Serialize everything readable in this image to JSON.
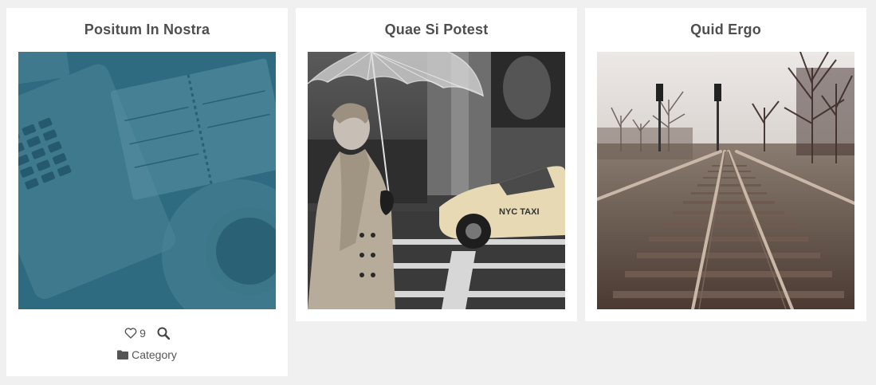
{
  "cards": [
    {
      "title": "Positum In Nostra",
      "image": "workspace-desk-teal-photo",
      "likes": "9",
      "category": "Category"
    },
    {
      "title": "Quae Si Potest",
      "image": "woman-with-umbrella-taxi-photo",
      "taxi_text": "NYC TAXI"
    },
    {
      "title": "Quid Ergo",
      "image": "railroad-tracks-photo"
    }
  ],
  "colors": {
    "background": "#f0f0f0",
    "card": "#ffffff",
    "title": "#4f4f4f",
    "overlay_teal": "#2e6a80"
  },
  "icons": [
    "heart-icon",
    "search-icon",
    "folder-icon"
  ]
}
